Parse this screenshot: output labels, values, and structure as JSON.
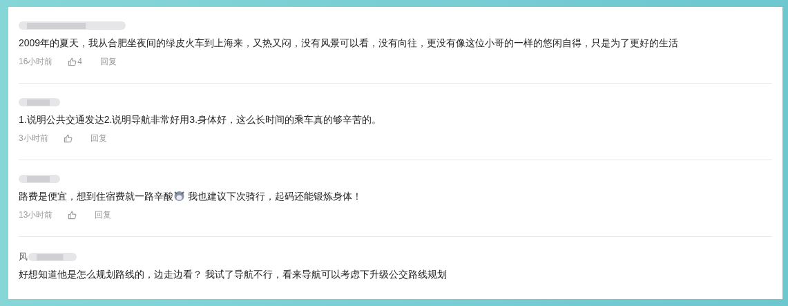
{
  "comments": [
    {
      "text": "2009年的夏天，我从合肥坐夜间的绿皮火车到上海来，又热又闷，没有风景可以看，没有向往，更没有像这位小哥的一样的悠闲自得，只是为了更好的生活",
      "time": "16小时前",
      "likes": "4",
      "reply": "回复"
    },
    {
      "text": "1.说明公共交通发达2.说明导航非常好用3.身体好，这么长时间的乘车真的够辛苦的。",
      "time": "3小时前",
      "reply": "回复"
    },
    {
      "text": "路费是便宜，想到住宿费就一路辛酸",
      "text_after_emoji": " 我也建议下次骑行，起码还能锻炼身体！",
      "time": "13小时前",
      "reply": "回复"
    },
    {
      "name_prefix": "风",
      "text": "好想知道他是怎么规划路线的，边走边看？ 我试了导航不行，看来导航可以考虑下升级公交路线规划"
    }
  ]
}
